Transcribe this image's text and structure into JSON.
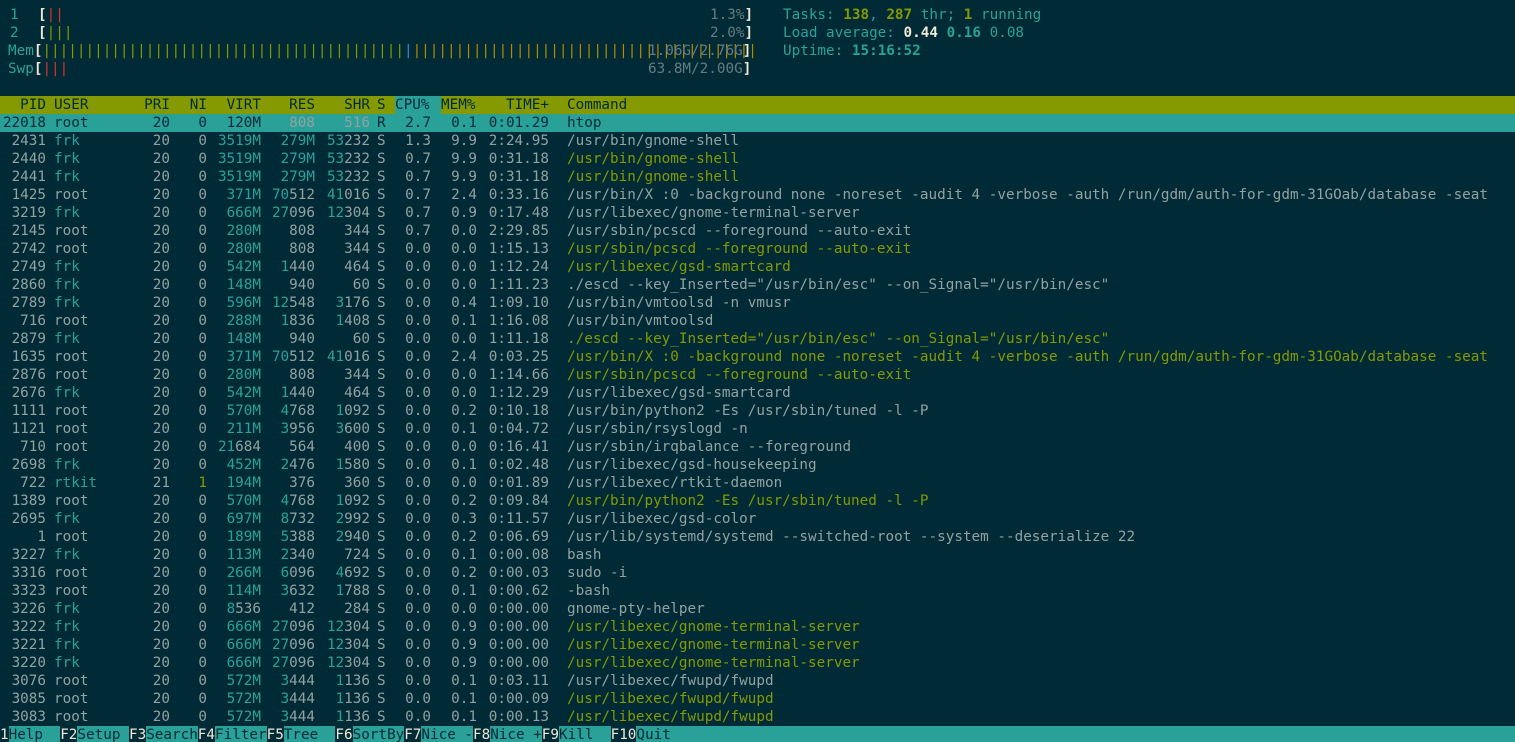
{
  "meters": {
    "cpu1": {
      "label": "1",
      "bars": "||",
      "value": "1.3%"
    },
    "cpu2": {
      "label": "2",
      "bars": "|||",
      "value": "2.0%"
    },
    "mem": {
      "label": "Mem",
      "bars_green": "||||||||||||||||||||||||||||||||||||||||||",
      "bars_blue": "|",
      "bars_yellow": "||||||||||||||||||||||||||||||||||||||||",
      "value": "1.06G/2.76G"
    },
    "swp": {
      "label": "Swp",
      "bars": "|||",
      "value": "63.8M/2.00G"
    }
  },
  "summary": {
    "tasks_label": "Tasks: ",
    "tasks": "138",
    "threads": "287",
    "thr_label": " thr; ",
    "running": "1",
    "running_label": " running",
    "load_label": "Load average: ",
    "load1": "0.44",
    "load5": "0.16",
    "load15": "0.08",
    "uptime_label": "Uptime: ",
    "uptime": "15:16:52"
  },
  "columns": [
    "PID",
    "USER",
    "PRI",
    "NI",
    "VIRT",
    "RES",
    "SHR",
    "S",
    "CPU%",
    "MEM%",
    "TIME+",
    "Command"
  ],
  "sorted_column": "CPU%",
  "processes": [
    {
      "pid": "22018",
      "user": "root",
      "pri": "20",
      "ni": "0",
      "virt": "120M",
      "res": "2808",
      "shr": "1516",
      "s": "R",
      "cpu": "2.7",
      "mem": "0.1",
      "time": "0:01.29",
      "cmd": "htop",
      "thread": false,
      "selected": true
    },
    {
      "pid": "2431",
      "user": "frk",
      "pri": "20",
      "ni": "0",
      "virt": "3519M",
      "res": "279M",
      "shr": "53232",
      "s": "S",
      "cpu": "1.3",
      "mem": "9.9",
      "time": "2:24.95",
      "cmd": "/usr/bin/gnome-shell",
      "thread": false
    },
    {
      "pid": "2440",
      "user": "frk",
      "pri": "20",
      "ni": "0",
      "virt": "3519M",
      "res": "279M",
      "shr": "53232",
      "s": "S",
      "cpu": "0.7",
      "mem": "9.9",
      "time": "0:31.18",
      "cmd": "/usr/bin/gnome-shell",
      "thread": true
    },
    {
      "pid": "2441",
      "user": "frk",
      "pri": "20",
      "ni": "0",
      "virt": "3519M",
      "res": "279M",
      "shr": "53232",
      "s": "S",
      "cpu": "0.7",
      "mem": "9.9",
      "time": "0:31.18",
      "cmd": "/usr/bin/gnome-shell",
      "thread": true
    },
    {
      "pid": "1425",
      "user": "root",
      "pri": "20",
      "ni": "0",
      "virt": "371M",
      "res": "70512",
      "shr": "41016",
      "s": "S",
      "cpu": "0.7",
      "mem": "2.4",
      "time": "0:33.16",
      "cmd": "/usr/bin/X :0 -background none -noreset -audit 4 -verbose -auth /run/gdm/auth-for-gdm-31GOab/database -seat",
      "thread": false
    },
    {
      "pid": "3219",
      "user": "frk",
      "pri": "20",
      "ni": "0",
      "virt": "666M",
      "res": "27096",
      "shr": "12304",
      "s": "S",
      "cpu": "0.7",
      "mem": "0.9",
      "time": "0:17.48",
      "cmd": "/usr/libexec/gnome-terminal-server",
      "thread": false
    },
    {
      "pid": "2145",
      "user": "root",
      "pri": "20",
      "ni": "0",
      "virt": "280M",
      "res": "808",
      "shr": "344",
      "s": "S",
      "cpu": "0.7",
      "mem": "0.0",
      "time": "2:29.85",
      "cmd": "/usr/sbin/pcscd --foreground --auto-exit",
      "thread": false
    },
    {
      "pid": "2742",
      "user": "root",
      "pri": "20",
      "ni": "0",
      "virt": "280M",
      "res": "808",
      "shr": "344",
      "s": "S",
      "cpu": "0.0",
      "mem": "0.0",
      "time": "1:15.13",
      "cmd": "/usr/sbin/pcscd --foreground --auto-exit",
      "thread": true
    },
    {
      "pid": "2749",
      "user": "frk",
      "pri": "20",
      "ni": "0",
      "virt": "542M",
      "res": "1440",
      "shr": "464",
      "s": "S",
      "cpu": "0.0",
      "mem": "0.0",
      "time": "1:12.24",
      "cmd": "/usr/libexec/gsd-smartcard",
      "thread": true
    },
    {
      "pid": "2860",
      "user": "frk",
      "pri": "20",
      "ni": "0",
      "virt": "148M",
      "res": "940",
      "shr": "60",
      "s": "S",
      "cpu": "0.0",
      "mem": "0.0",
      "time": "1:11.23",
      "cmd": "./escd --key_Inserted=\"/usr/bin/esc\" --on_Signal=\"/usr/bin/esc\"",
      "thread": false
    },
    {
      "pid": "2789",
      "user": "frk",
      "pri": "20",
      "ni": "0",
      "virt": "596M",
      "res": "12548",
      "shr": "3176",
      "s": "S",
      "cpu": "0.0",
      "mem": "0.4",
      "time": "1:09.10",
      "cmd": "/usr/bin/vmtoolsd -n vmusr",
      "thread": false
    },
    {
      "pid": "716",
      "user": "root",
      "pri": "20",
      "ni": "0",
      "virt": "288M",
      "res": "1836",
      "shr": "1408",
      "s": "S",
      "cpu": "0.0",
      "mem": "0.1",
      "time": "1:16.08",
      "cmd": "/usr/bin/vmtoolsd",
      "thread": false
    },
    {
      "pid": "2879",
      "user": "frk",
      "pri": "20",
      "ni": "0",
      "virt": "148M",
      "res": "940",
      "shr": "60",
      "s": "S",
      "cpu": "0.0",
      "mem": "0.0",
      "time": "1:11.18",
      "cmd": "./escd --key_Inserted=\"/usr/bin/esc\" --on_Signal=\"/usr/bin/esc\"",
      "thread": true
    },
    {
      "pid": "1635",
      "user": "root",
      "pri": "20",
      "ni": "0",
      "virt": "371M",
      "res": "70512",
      "shr": "41016",
      "s": "S",
      "cpu": "0.0",
      "mem": "2.4",
      "time": "0:03.25",
      "cmd": "/usr/bin/X :0 -background none -noreset -audit 4 -verbose -auth /run/gdm/auth-for-gdm-31GOab/database -seat",
      "thread": true
    },
    {
      "pid": "2876",
      "user": "root",
      "pri": "20",
      "ni": "0",
      "virt": "280M",
      "res": "808",
      "shr": "344",
      "s": "S",
      "cpu": "0.0",
      "mem": "0.0",
      "time": "1:14.66",
      "cmd": "/usr/sbin/pcscd --foreground --auto-exit",
      "thread": true
    },
    {
      "pid": "2676",
      "user": "frk",
      "pri": "20",
      "ni": "0",
      "virt": "542M",
      "res": "1440",
      "shr": "464",
      "s": "S",
      "cpu": "0.0",
      "mem": "0.0",
      "time": "1:12.29",
      "cmd": "/usr/libexec/gsd-smartcard",
      "thread": false
    },
    {
      "pid": "1111",
      "user": "root",
      "pri": "20",
      "ni": "0",
      "virt": "570M",
      "res": "4768",
      "shr": "1092",
      "s": "S",
      "cpu": "0.0",
      "mem": "0.2",
      "time": "0:10.18",
      "cmd": "/usr/bin/python2 -Es /usr/sbin/tuned -l -P",
      "thread": false
    },
    {
      "pid": "1121",
      "user": "root",
      "pri": "20",
      "ni": "0",
      "virt": "211M",
      "res": "3956",
      "shr": "3600",
      "s": "S",
      "cpu": "0.0",
      "mem": "0.1",
      "time": "0:04.72",
      "cmd": "/usr/sbin/rsyslogd -n",
      "thread": false
    },
    {
      "pid": "710",
      "user": "root",
      "pri": "20",
      "ni": "0",
      "virt": "21684",
      "res": "564",
      "shr": "400",
      "s": "S",
      "cpu": "0.0",
      "mem": "0.0",
      "time": "0:16.41",
      "cmd": "/usr/sbin/irqbalance --foreground",
      "thread": false
    },
    {
      "pid": "2698",
      "user": "frk",
      "pri": "20",
      "ni": "0",
      "virt": "452M",
      "res": "2476",
      "shr": "1580",
      "s": "S",
      "cpu": "0.0",
      "mem": "0.1",
      "time": "0:02.48",
      "cmd": "/usr/libexec/gsd-housekeeping",
      "thread": false
    },
    {
      "pid": "722",
      "user": "rtkit",
      "pri": "21",
      "ni": "1",
      "virt": "194M",
      "res": "376",
      "shr": "360",
      "s": "S",
      "cpu": "0.0",
      "mem": "0.0",
      "time": "0:01.89",
      "cmd": "/usr/libexec/rtkit-daemon",
      "thread": false
    },
    {
      "pid": "1389",
      "user": "root",
      "pri": "20",
      "ni": "0",
      "virt": "570M",
      "res": "4768",
      "shr": "1092",
      "s": "S",
      "cpu": "0.0",
      "mem": "0.2",
      "time": "0:09.84",
      "cmd": "/usr/bin/python2 -Es /usr/sbin/tuned -l -P",
      "thread": true
    },
    {
      "pid": "2695",
      "user": "frk",
      "pri": "20",
      "ni": "0",
      "virt": "697M",
      "res": "8732",
      "shr": "2992",
      "s": "S",
      "cpu": "0.0",
      "mem": "0.3",
      "time": "0:11.57",
      "cmd": "/usr/libexec/gsd-color",
      "thread": false
    },
    {
      "pid": "1",
      "user": "root",
      "pri": "20",
      "ni": "0",
      "virt": "189M",
      "res": "5388",
      "shr": "2940",
      "s": "S",
      "cpu": "0.0",
      "mem": "0.2",
      "time": "0:06.69",
      "cmd": "/usr/lib/systemd/systemd --switched-root --system --deserialize 22",
      "thread": false
    },
    {
      "pid": "3227",
      "user": "frk",
      "pri": "20",
      "ni": "0",
      "virt": "113M",
      "res": "2340",
      "shr": "724",
      "s": "S",
      "cpu": "0.0",
      "mem": "0.1",
      "time": "0:00.08",
      "cmd": "bash",
      "thread": false
    },
    {
      "pid": "3316",
      "user": "root",
      "pri": "20",
      "ni": "0",
      "virt": "266M",
      "res": "6096",
      "shr": "4692",
      "s": "S",
      "cpu": "0.0",
      "mem": "0.2",
      "time": "0:00.03",
      "cmd": "sudo -i",
      "thread": false
    },
    {
      "pid": "3323",
      "user": "root",
      "pri": "20",
      "ni": "0",
      "virt": "114M",
      "res": "3632",
      "shr": "1788",
      "s": "S",
      "cpu": "0.0",
      "mem": "0.1",
      "time": "0:00.62",
      "cmd": "-bash",
      "thread": false
    },
    {
      "pid": "3226",
      "user": "frk",
      "pri": "20",
      "ni": "0",
      "virt": "8536",
      "res": "412",
      "shr": "284",
      "s": "S",
      "cpu": "0.0",
      "mem": "0.0",
      "time": "0:00.00",
      "cmd": "gnome-pty-helper",
      "thread": false
    },
    {
      "pid": "3222",
      "user": "frk",
      "pri": "20",
      "ni": "0",
      "virt": "666M",
      "res": "27096",
      "shr": "12304",
      "s": "S",
      "cpu": "0.0",
      "mem": "0.9",
      "time": "0:00.00",
      "cmd": "/usr/libexec/gnome-terminal-server",
      "thread": true
    },
    {
      "pid": "3221",
      "user": "frk",
      "pri": "20",
      "ni": "0",
      "virt": "666M",
      "res": "27096",
      "shr": "12304",
      "s": "S",
      "cpu": "0.0",
      "mem": "0.9",
      "time": "0:00.00",
      "cmd": "/usr/libexec/gnome-terminal-server",
      "thread": true
    },
    {
      "pid": "3220",
      "user": "frk",
      "pri": "20",
      "ni": "0",
      "virt": "666M",
      "res": "27096",
      "shr": "12304",
      "s": "S",
      "cpu": "0.0",
      "mem": "0.9",
      "time": "0:00.00",
      "cmd": "/usr/libexec/gnome-terminal-server",
      "thread": true
    },
    {
      "pid": "3076",
      "user": "root",
      "pri": "20",
      "ni": "0",
      "virt": "572M",
      "res": "3444",
      "shr": "1136",
      "s": "S",
      "cpu": "0.0",
      "mem": "0.1",
      "time": "0:03.11",
      "cmd": "/usr/libexec/fwupd/fwupd",
      "thread": false
    },
    {
      "pid": "3085",
      "user": "root",
      "pri": "20",
      "ni": "0",
      "virt": "572M",
      "res": "3444",
      "shr": "1136",
      "s": "S",
      "cpu": "0.0",
      "mem": "0.1",
      "time": "0:00.09",
      "cmd": "/usr/libexec/fwupd/fwupd",
      "thread": true
    },
    {
      "pid": "3083",
      "user": "root",
      "pri": "20",
      "ni": "0",
      "virt": "572M",
      "res": "3444",
      "shr": "1136",
      "s": "S",
      "cpu": "0.0",
      "mem": "0.1",
      "time": "0:00.13",
      "cmd": "/usr/libexec/fwupd/fwupd",
      "thread": true
    }
  ],
  "function_keys": [
    {
      "key": "1",
      "label": "Help  "
    },
    {
      "key": "F2",
      "label": "Setup "
    },
    {
      "key": "F3",
      "label": "Search"
    },
    {
      "key": "F4",
      "label": "Filter"
    },
    {
      "key": "F5",
      "label": "Tree  "
    },
    {
      "key": "F6",
      "label": "SortBy"
    },
    {
      "key": "F7",
      "label": "Nice -"
    },
    {
      "key": "F8",
      "label": "Nice +"
    },
    {
      "key": "F9",
      "label": "Kill  "
    },
    {
      "key": "F10",
      "label": "Quit"
    }
  ],
  "colors": {
    "background": "#002b36",
    "header": "#859900",
    "selection": "#2aa198",
    "thread": "#859900",
    "cyan": "#2aa198"
  }
}
